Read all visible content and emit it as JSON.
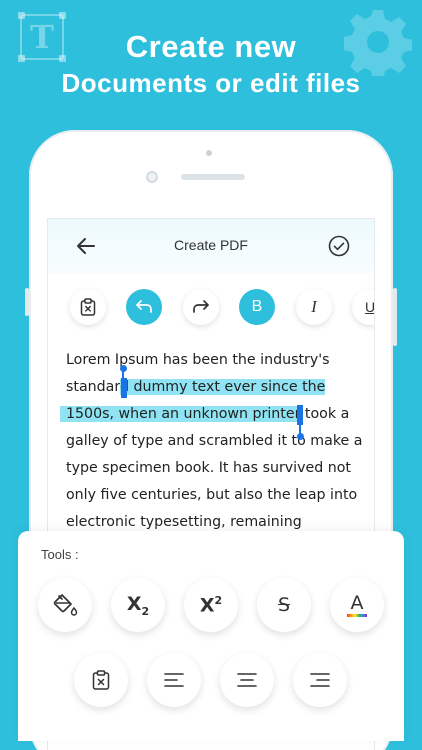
{
  "headline": {
    "line1": "Create new",
    "line2": "Documents or edit  files"
  },
  "decor": {
    "left_letter": "T"
  },
  "app": {
    "title": "Create PDF"
  },
  "toolbar": {
    "bold_label": "B",
    "italic_label": "I",
    "underline_label": "U"
  },
  "document": {
    "line1": "Lorem Ipsum has been the industry's",
    "line2_a": "standar",
    "line2_sel": "d dummy text ever since the",
    "line3_sel": "1500s, when an unknown printer",
    "line3_b": " took a",
    "line4": "galley of type and scrambled it to make a",
    "line5": "type specimen book. It has survived not",
    "line6": "only five centuries, but also the leap into",
    "line7": "electronic typesetting, remaining"
  },
  "tools": {
    "label": "Tools :",
    "subscript_base": "X",
    "subscript_mark": "2",
    "superscript_base": "X",
    "superscript_mark": "2",
    "strike_label": "S",
    "font_color_label": "A"
  },
  "colors": {
    "accent": "#2ebfdd",
    "selection": "#8fe3f2",
    "caret": "#1c73e4"
  }
}
